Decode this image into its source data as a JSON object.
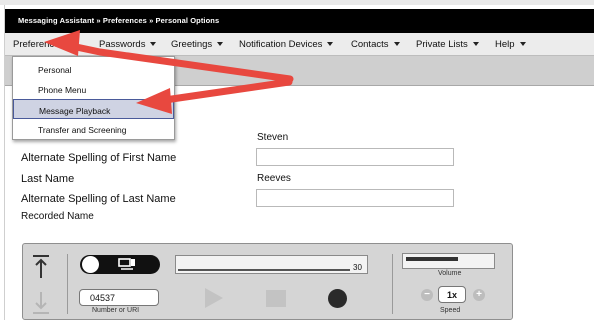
{
  "breadcrumb": {
    "text": "Messaging Assistant » Preferences » Personal Options"
  },
  "menubar": {
    "items": [
      {
        "label": "Preferences"
      },
      {
        "label": "Passwords"
      },
      {
        "label": "Greetings"
      },
      {
        "label": "Notification Devices"
      },
      {
        "label": "Contacts"
      },
      {
        "label": "Private Lists"
      },
      {
        "label": "Help"
      }
    ]
  },
  "dropdown": {
    "items": [
      {
        "label": "Personal"
      },
      {
        "label": "Phone Menu"
      },
      {
        "label": "Message Playback",
        "selected": true
      },
      {
        "label": "Transfer and Screening"
      }
    ]
  },
  "form": {
    "first_name_value": "Steven",
    "alt_first_label": "Alternate Spelling of First Name",
    "alt_first_value": "",
    "last_name_label": "Last Name",
    "last_name_value": "Reeves",
    "alt_last_label": "Alternate Spelling of Last Name",
    "alt_last_value": "",
    "recorded_name_label": "Recorded Name"
  },
  "player": {
    "progress_value": "30",
    "number_value": "04537",
    "number_label": "Number or URI",
    "volume_label": "Volume",
    "volume_level": 0.6,
    "speed_value": "1x",
    "speed_label": "Speed"
  },
  "icons": {
    "player": [
      "upload-icon",
      "download-icon",
      "device-icon",
      "play-icon",
      "stop-icon",
      "record-icon",
      "minus-icon",
      "plus-icon"
    ],
    "annotation": "red-arrow-icon"
  },
  "colors": {
    "annotation_arrow": "#e8483f",
    "selected_item": "#cfd3e3",
    "breadcrumb_bg": "#000000"
  }
}
